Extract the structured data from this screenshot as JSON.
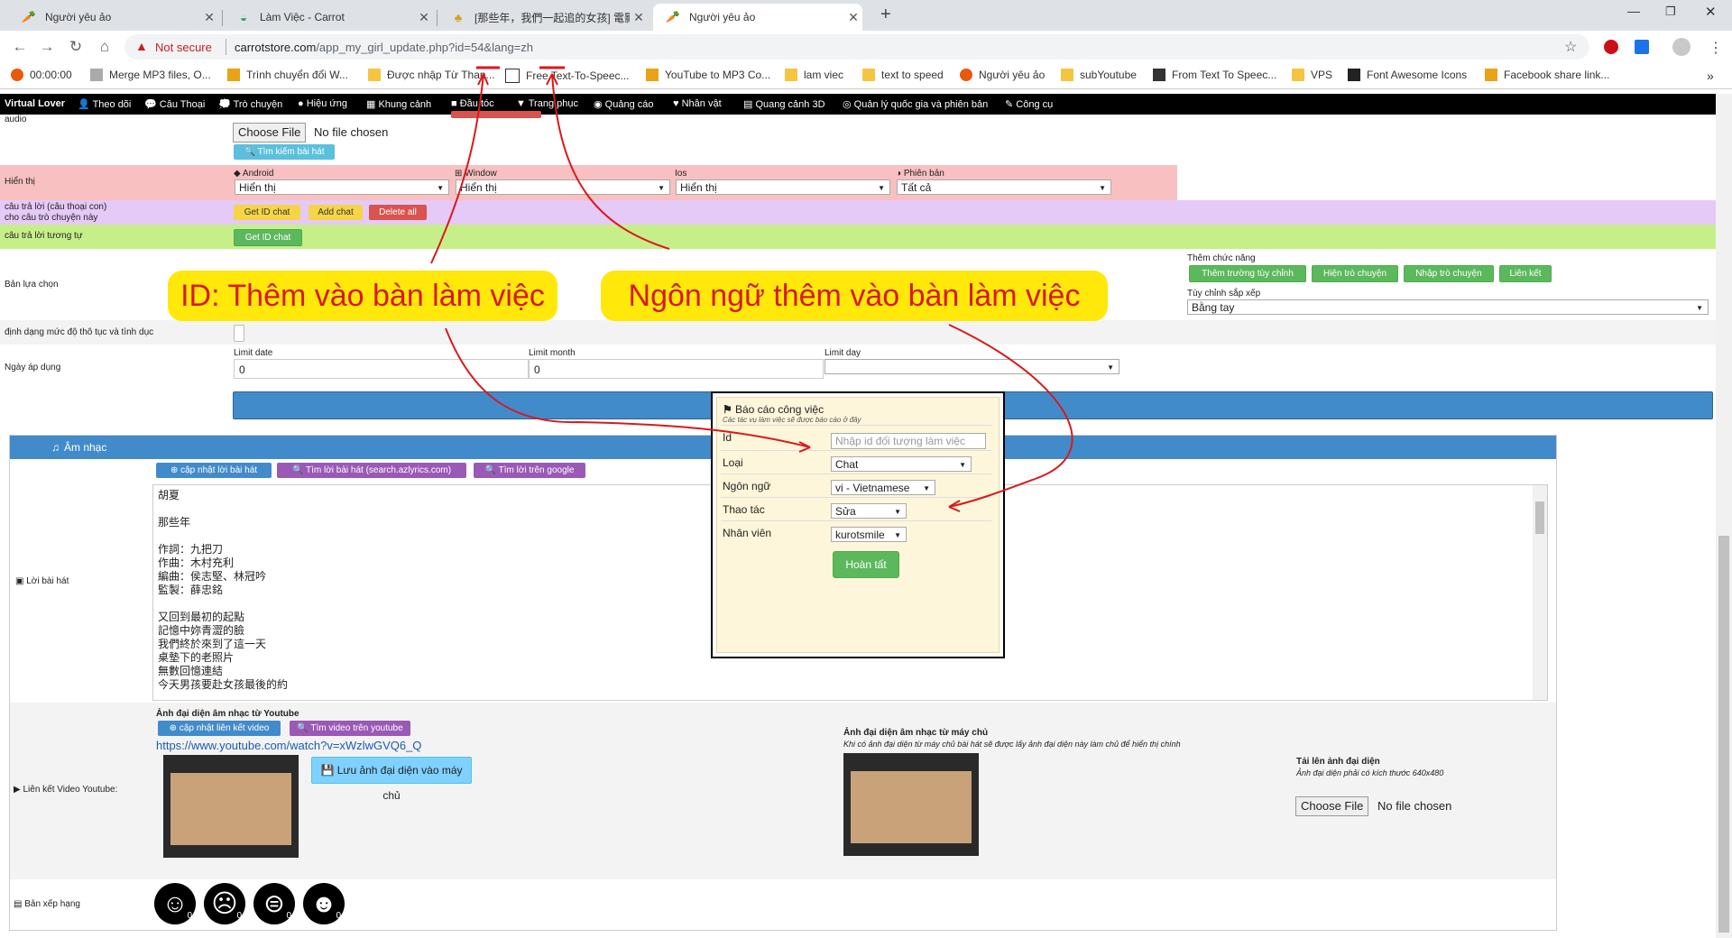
{
  "tabs": [
    {
      "title": "Người yêu ảo"
    },
    {
      "title": "Làm Việc - Carrot"
    },
    {
      "title": "[那些年，我們一起追的女孩] 電影"
    },
    {
      "title": "Người yêu ảo"
    }
  ],
  "address": {
    "security": "Not secure",
    "host": "carrotstore.com",
    "path": "/app_my_girl_update.php?id=54&lang=zh"
  },
  "bookmarks": [
    "00:00:00",
    "Merge MP3 files, O...",
    "Trình chuyển đổi W...",
    "Được nhập Từ Than...",
    "Free Text-To-Speec...",
    "YouTube to MP3 Co...",
    "lam viec",
    "text to speed",
    "Người yêu ảo",
    "subYoutube",
    "From Text To Speec...",
    "VPS",
    "Font Awesome Icons",
    "Facebook share link..."
  ],
  "menu": [
    "Virtual Lover",
    "Theo dõi",
    "Câu Thoại",
    "Trò chuyện",
    "Hiệu ứng",
    "Khung cảnh",
    "Đầu tóc",
    "Trang phục",
    "Quảng cáo",
    "Nhân vật",
    "Quang cảnh 3D",
    "Quản lý quốc gia và phiên bản",
    "Công cụ"
  ],
  "audio": {
    "label": "audio",
    "choose_file": "Choose File",
    "no_file": "No file chosen",
    "search_song": "Tìm kiếm bài hát"
  },
  "display": {
    "label": "Hiển thị",
    "android_label": "Android",
    "android_value": "Hiển thị",
    "window_label": "Window",
    "window_value": "Hiển thị",
    "ios_label": "Ios",
    "ios_value": "Hiển thị",
    "version_label": "Phiên bản",
    "version_value": "Tất cả"
  },
  "child_reply": {
    "label_line1": "câu trả lời (câu thoại con)",
    "label_line2": "cho câu trò chuyện này",
    "get_id": "Get ID chat",
    "add_chat": "Add chat",
    "delete_all": "Delete all"
  },
  "similar_reply": {
    "label": "câu trả lời tương tự",
    "get_id": "Get ID chat"
  },
  "options": {
    "label": "Bản lựa chọn",
    "extra_label": "Thêm chức năng",
    "btn_custom_field": "Thêm trường tùy chỉnh",
    "btn_show_chat": "Hiện trò chuyện",
    "btn_import_chat": "Nhập trò chuyện",
    "btn_link": "Liên kết",
    "sort_label": "Tùy chỉnh sắp xếp",
    "sort_value": "Bằng tay"
  },
  "rude_level": {
    "label": "định dạng mức độ thô tục và tình dục"
  },
  "apply_date": {
    "label": "Ngày áp dụng",
    "limit_date_label": "Limit date",
    "limit_date_value": "0",
    "limit_month_label": "Limit month",
    "limit_month_value": "0",
    "limit_day_label": "Limit day"
  },
  "callouts": {
    "id_note": "ID: Thêm vào bàn làm việc",
    "lang_note": "Ngôn ngữ thêm vào bàn làm việc"
  },
  "music": {
    "header": "Âm nhạc",
    "lyrics_label": "Lời bài hát",
    "btn_update_lyrics": "cập nhật lời bài hát",
    "btn_search_azlyrics": "Tìm lời bài hát (search.azlyrics.com)",
    "btn_search_google": "Tìm lời trên google",
    "lyrics_lines": [
      "胡夏",
      "",
      "那些年",
      "",
      "作詞：九把刀",
      "作曲：木村充利",
      "編曲：侯志堅、林冠吟",
      "監製：薛忠銘",
      "",
      "又回到最初的起點",
      "記憶中妳青澀的臉",
      "我們終於來到了這一天",
      "桌墊下的老照片",
      "無數回憶連結",
      "今天男孩要赴女孩最後的約"
    ],
    "youtube_label": "Liên kết Video Youtube:",
    "yt_title": "Ảnh đại diện âm nhạc từ Youtube",
    "btn_update_video": "cập nhật liên kết video",
    "btn_search_youtube": "Tìm video trên youtube",
    "yt_url": "https://www.youtube.com/watch?v=xWzlwGVQ6_Q",
    "btn_save_thumb": "Lưu ảnh đại diện vào máy chủ",
    "server_title": "Ảnh đại diện âm nhạc từ máy chủ",
    "server_note": "Khi có ảnh đại diện từ máy chủ bài hát sẽ được lấy ảnh đại diện này làm chủ để hiển thị chính",
    "upload_title": "Tải lên ảnh đại diện",
    "upload_note": "Ảnh đại diện phải có kích thước 640x480",
    "upload_choose": "Choose File",
    "upload_none": "No file chosen",
    "rank_label": "Bản xếp hạng",
    "ranks": [
      "0",
      "0",
      "0",
      "0"
    ]
  },
  "dialog": {
    "title": "Báo cáo công việc",
    "subtitle": "Các tác vụ làm việc sẽ được báo cáo ở đây",
    "id_label": "Id",
    "id_placeholder": "Nhập id đối tượng làm việc",
    "type_label": "Loại",
    "type_value": "Chat",
    "lang_label": "Ngôn ngữ",
    "lang_value": "vi - Vietnamese",
    "action_label": "Thao tác",
    "action_value": "Sửa",
    "staff_label": "Nhân viên",
    "staff_value": "kurotsmile",
    "submit": "Hoàn tất"
  },
  "colors": {
    "pink_row": "#f8c0c0",
    "purple_row": "#e5c9f7",
    "green_row": "#c6ef8a",
    "music_header": "#428bca",
    "callout": "#ffe80a",
    "arrow": "#d9191c"
  }
}
